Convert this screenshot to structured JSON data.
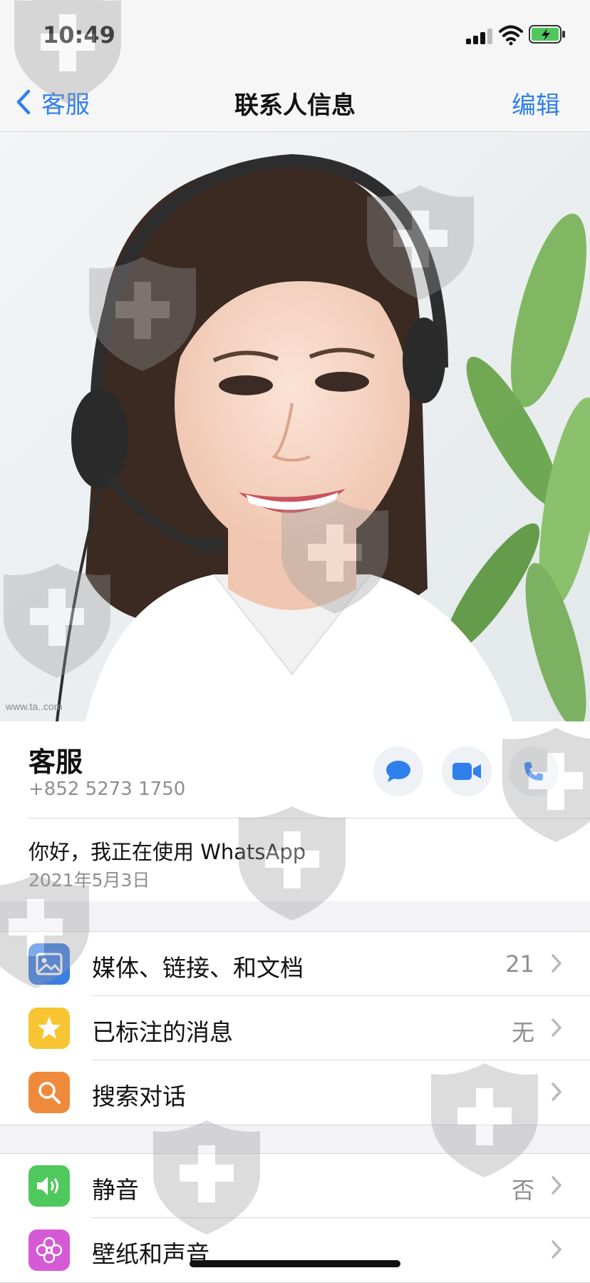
{
  "status_bar": {
    "time": "10:49"
  },
  "nav": {
    "back_label": "客服",
    "title": "联系人信息",
    "edit_label": "编辑"
  },
  "contact": {
    "name": "客服",
    "phone": "+852 5273 1750",
    "about": "你好，我正在使用 WhatsApp",
    "about_date": "2021年5月3日"
  },
  "photo": {
    "watermark_text": "www.ta..com"
  },
  "section1": [
    {
      "label": "媒体、链接、和文档",
      "value": "21",
      "icon": "photo-icon",
      "color": "#3b7de3"
    },
    {
      "label": "已标注的消息",
      "value": "无",
      "icon": "star-icon",
      "color": "#f7c531"
    },
    {
      "label": "搜索对话",
      "value": "",
      "icon": "search-icon",
      "color": "#ef8a3c"
    }
  ],
  "section2": [
    {
      "label": "静音",
      "value": "否",
      "icon": "speaker-icon",
      "color": "#4fc85d"
    },
    {
      "label": "壁纸和声音",
      "value": "",
      "icon": "flower-icon",
      "color": "#d65ad6"
    }
  ],
  "colors": {
    "accent": "#2f80ed",
    "background": "#f2f2f7",
    "text_secondary": "#8e8e93"
  }
}
